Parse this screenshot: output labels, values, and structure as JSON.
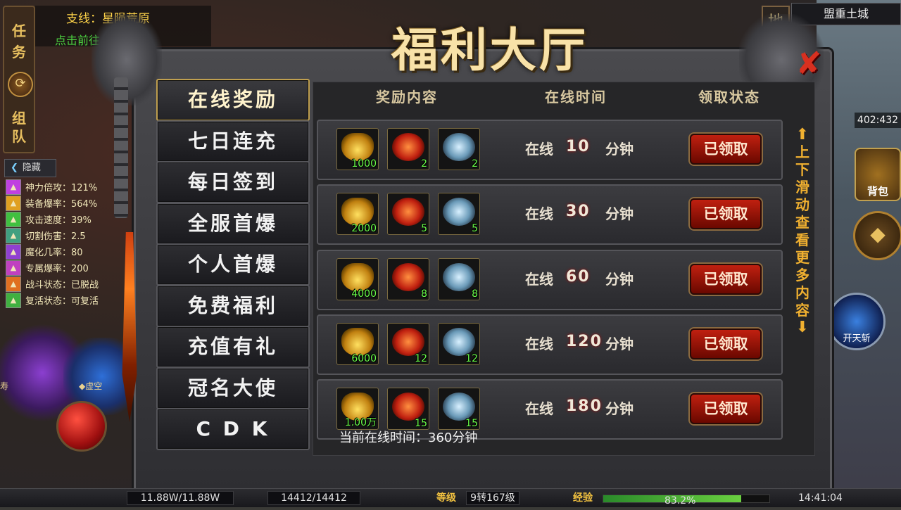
{
  "hud": {
    "quest_tab": [
      "任",
      "务"
    ],
    "team_tab": [
      "组",
      "队"
    ],
    "quest_line": "支线：星陨荒原",
    "quest_hint": "点击前往",
    "hide_label": "隐藏",
    "buffs": [
      {
        "label": "神力倍攻：121%",
        "color": "#c040e0"
      },
      {
        "label": "装备爆率：564%",
        "color": "#e0a020"
      },
      {
        "label": "攻击速度：39%",
        "color": "#40c040"
      },
      {
        "label": "切割伤害：2.5",
        "color": "#40a080"
      },
      {
        "label": "魔化几率：80",
        "color": "#9040d0"
      },
      {
        "label": "专属爆率：200",
        "color": "#c040c0"
      },
      {
        "label": "战斗状态：已脱战",
        "color": "#e07020"
      },
      {
        "label": "复活状态：可复活",
        "color": "#40b040"
      }
    ],
    "left_skill_1": "寿",
    "left_skill_2": "◆虚空",
    "map_button": "地",
    "map_name": "盟重土城",
    "coords": "402:432",
    "bag_label": "背包",
    "skill_label": "开天斩",
    "status": {
      "hp": "11.88W/11.88W",
      "mp": "14412/14412",
      "level_label": "等级",
      "level_value": "9转167级",
      "exp_label": "经验",
      "exp_percent": "83.2%",
      "exp_fraction": 0.832,
      "time": "14:41:04"
    }
  },
  "dialog": {
    "title": "福利大厅",
    "close": "✘",
    "menu": [
      {
        "label": "在线奖励",
        "active": true
      },
      {
        "label": "七日连充",
        "active": false
      },
      {
        "label": "每日签到",
        "active": false
      },
      {
        "label": "全服首爆",
        "active": false
      },
      {
        "label": "个人首爆",
        "active": false
      },
      {
        "label": "免费福利",
        "active": false
      },
      {
        "label": "充值有礼",
        "active": false
      },
      {
        "label": "冠名大使",
        "active": false
      },
      {
        "label": "C D K",
        "active": false
      }
    ],
    "headers": {
      "reward": "奖励内容",
      "time": "在线时间",
      "status": "领取状态"
    },
    "online_prefix": "在线",
    "minute_suffix": "分钟",
    "rows": [
      {
        "gold": "1000",
        "fire": "2",
        "ice": "2",
        "minutes": "10",
        "status": "已领取"
      },
      {
        "gold": "2000",
        "fire": "5",
        "ice": "5",
        "minutes": "30",
        "status": "已领取"
      },
      {
        "gold": "4000",
        "fire": "8",
        "ice": "8",
        "minutes": "60",
        "status": "已领取"
      },
      {
        "gold": "6000",
        "fire": "12",
        "ice": "12",
        "minutes": "120",
        "status": "已领取"
      },
      {
        "gold": "1.00万",
        "fire": "15",
        "ice": "15",
        "minutes": "180",
        "status": "已领取"
      }
    ],
    "scroll_hint": [
      "上",
      "下",
      "滑",
      "动",
      "查",
      "看",
      "更",
      "多",
      "内",
      "容"
    ],
    "current_online": "当前在线时间：360分钟"
  }
}
